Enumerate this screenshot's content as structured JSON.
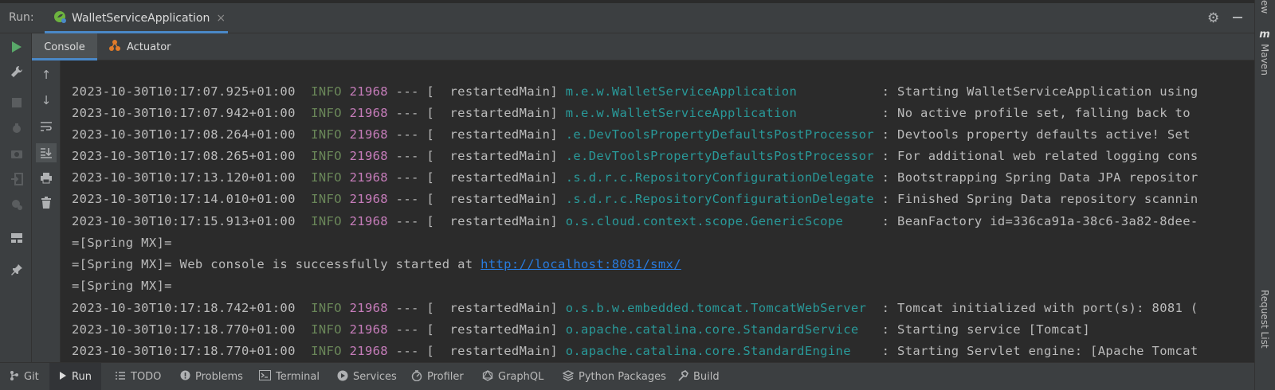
{
  "header": {
    "run_label": "Run:",
    "tab_title": "WalletServiceApplication",
    "tab_close": "×"
  },
  "sub_tabs": {
    "console": "Console",
    "actuator": "Actuator"
  },
  "console_lines": [
    {
      "time": "2023-10-30T10:17:07.925+01:00",
      "level": "INFO",
      "pid": "21968",
      "thread": " --- [  restartedMain] ",
      "logger": "m.e.w.WalletServiceApplication          ",
      "message": " : Starting WalletServiceApplication using"
    },
    {
      "time": "2023-10-30T10:17:07.942+01:00",
      "level": "INFO",
      "pid": "21968",
      "thread": " --- [  restartedMain] ",
      "logger": "m.e.w.WalletServiceApplication          ",
      "message": " : No active profile set, falling back to"
    },
    {
      "time": "2023-10-30T10:17:08.264+01:00",
      "level": "INFO",
      "pid": "21968",
      "thread": " --- [  restartedMain] ",
      "logger": ".e.DevToolsPropertyDefaultsPostProcessor",
      "message": " : Devtools property defaults active! Set"
    },
    {
      "time": "2023-10-30T10:17:08.265+01:00",
      "level": "INFO",
      "pid": "21968",
      "thread": " --- [  restartedMain] ",
      "logger": ".e.DevToolsPropertyDefaultsPostProcessor",
      "message": " : For additional web related logging cons"
    },
    {
      "time": "2023-10-30T10:17:13.120+01:00",
      "level": "INFO",
      "pid": "21968",
      "thread": " --- [  restartedMain] ",
      "logger": ".s.d.r.c.RepositoryConfigurationDelegate",
      "message": " : Bootstrapping Spring Data JPA repositor"
    },
    {
      "time": "2023-10-30T10:17:14.010+01:00",
      "level": "INFO",
      "pid": "21968",
      "thread": " --- [  restartedMain] ",
      "logger": ".s.d.r.c.RepositoryConfigurationDelegate",
      "message": " : Finished Spring Data repository scannin"
    },
    {
      "time": "2023-10-30T10:17:15.913+01:00",
      "level": "INFO",
      "pid": "21968",
      "thread": " --- [  restartedMain] ",
      "logger": "o.s.cloud.context.scope.GenericScope    ",
      "message": " : BeanFactory id=336ca91a-38c6-3a82-8dee-"
    },
    {
      "plain": "=[Spring MX]="
    },
    {
      "plain": "=[Spring MX]= Web console is successfully started at ",
      "link": "http://localhost:8081/smx/"
    },
    {
      "plain": "=[Spring MX]="
    },
    {
      "time": "2023-10-30T10:17:18.742+01:00",
      "level": "INFO",
      "pid": "21968",
      "thread": " --- [  restartedMain] ",
      "logger": "o.s.b.w.embedded.tomcat.TomcatWebServer ",
      "message": " : Tomcat initialized with port(s): 8081 ("
    },
    {
      "time": "2023-10-30T10:17:18.770+01:00",
      "level": "INFO",
      "pid": "21968",
      "thread": " --- [  restartedMain] ",
      "logger": "o.apache.catalina.core.StandardService  ",
      "message": " : Starting service [Tomcat]"
    },
    {
      "time": "2023-10-30T10:17:18.770+01:00",
      "level": "INFO",
      "pid": "21968",
      "thread": " --- [  restartedMain] ",
      "logger": "o.apache.catalina.core.StandardEngine   ",
      "message": " : Starting Servlet engine: [Apache Tomcat"
    }
  ],
  "right_bar": {
    "maven": "Maven",
    "request_list": "Request List",
    "top_label": "ew"
  },
  "bottom_bar": [
    {
      "icon": "git-icon",
      "label": "Git"
    },
    {
      "icon": "run-icon",
      "label": "Run"
    },
    {
      "icon": "todo-icon",
      "label": "TODO"
    },
    {
      "icon": "problems-icon",
      "label": "Problems"
    },
    {
      "icon": "terminal-icon",
      "label": "Terminal"
    },
    {
      "icon": "services-icon",
      "label": "Services"
    },
    {
      "icon": "profiler-icon",
      "label": "Profiler"
    },
    {
      "icon": "graphql-icon",
      "label": "GraphQL"
    },
    {
      "icon": "python-packages-icon",
      "label": "Python Packages"
    },
    {
      "icon": "build-icon",
      "label": "Build"
    }
  ],
  "colors": {
    "accent": "#4a88c7",
    "info": "#6a8759",
    "pid": "#c77dbb",
    "logger": "#299999",
    "link": "#287bde"
  }
}
